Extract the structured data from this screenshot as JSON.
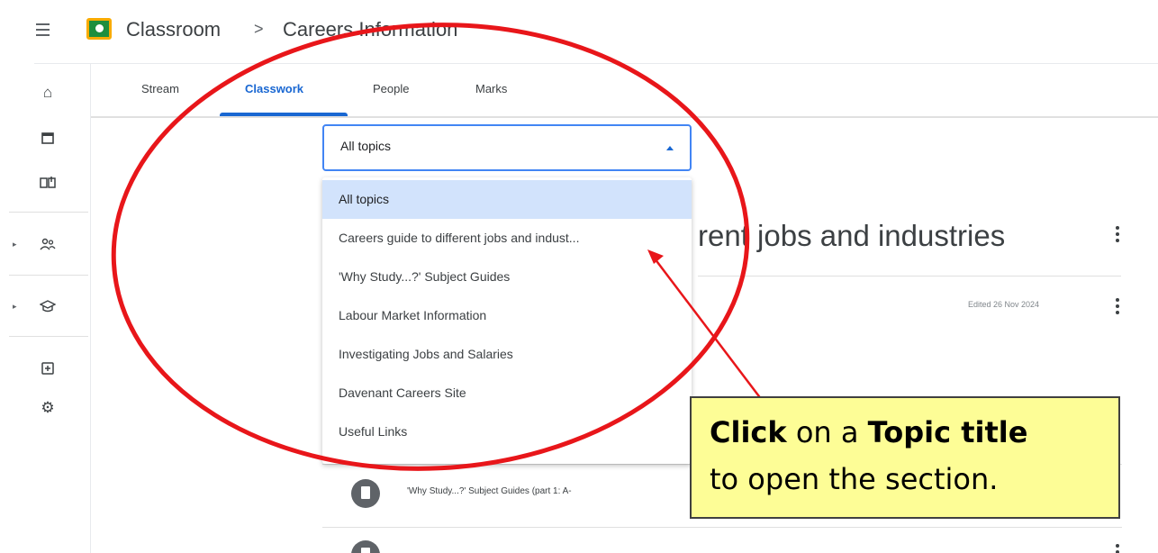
{
  "header": {
    "app_name": "Classroom",
    "separator": ">",
    "class_name": "Careers Information"
  },
  "tabs": [
    {
      "label": "Stream"
    },
    {
      "label": "Classwork"
    },
    {
      "label": "People"
    },
    {
      "label": "Marks"
    }
  ],
  "active_tab": "Classwork",
  "topic_filter": {
    "value": "All topics",
    "options": [
      "All topics",
      "Careers guide to different jobs and indust...",
      "'Why Study...?' Subject Guides",
      "Labour Market Information",
      "Investigating Jobs and Salaries",
      "Davenant Careers Site",
      "Useful Links"
    ]
  },
  "topic": {
    "heading_visible": "rent jobs and industries",
    "edited": "Edited 26 Nov 2024"
  },
  "assignments": [
    {
      "title_visible": "'Why Study...?' Subject Guides (part 1: A-"
    }
  ],
  "annotation": {
    "line1_bold": "Click",
    "line1_mid": " on a ",
    "line1_bold2": "Topic title",
    "line2": "to open the section."
  },
  "colors": {
    "accent": "#1967d2",
    "selected_option": "#d2e3fc",
    "annotation_red": "#e8161a",
    "callout_fill": "#fdfd96"
  }
}
